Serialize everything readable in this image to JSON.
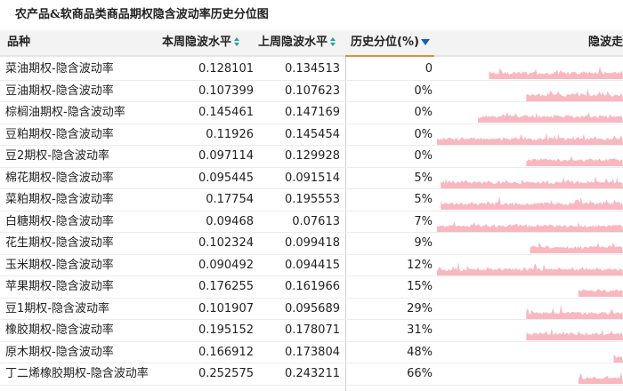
{
  "title": "农产品&软商品类商品期权隐含波动率历史分位图",
  "columns": {
    "name": "品种",
    "current": "本周隐波水平",
    "previous": "上周隐波水平",
    "percentile": "历史分位(%)",
    "trend": "隐波走"
  },
  "colors": {
    "spark_fill": "#f9b8c0",
    "sort_accent": "#2aa198",
    "active_sort_underline": "#e0923a"
  },
  "rows": [
    {
      "name": "菜油期权-隐含波动率",
      "current": "0.128101",
      "previous": "0.134513",
      "percentile": "0",
      "trend_start": 0.28
    },
    {
      "name": "豆油期权-隐含波动率",
      "current": "0.107399",
      "previous": "0.107623",
      "percentile": "0%",
      "trend_start": 0.48
    },
    {
      "name": "棕榈油期权-隐含波动率",
      "current": "0.145461",
      "previous": "0.147169",
      "percentile": "0%",
      "trend_start": 0.22
    },
    {
      "name": "豆粕期权-隐含波动率",
      "current": "0.11926",
      "previous": "0.145454",
      "percentile": "0%",
      "trend_start": 0.0
    },
    {
      "name": "豆2期权-隐含波动率",
      "current": "0.097114",
      "previous": "0.129928",
      "percentile": "0%",
      "trend_start": 0.48
    },
    {
      "name": "棉花期权-隐含波动率",
      "current": "0.095445",
      "previous": "0.091514",
      "percentile": "5%",
      "trend_start": 0.02
    },
    {
      "name": "菜粕期权-隐含波动率",
      "current": "0.17754",
      "previous": "0.195553",
      "percentile": "5%",
      "trend_start": 0.02
    },
    {
      "name": "白糖期权-隐含波动率",
      "current": "0.09468",
      "previous": "0.07613",
      "percentile": "7%",
      "trend_start": 0.0
    },
    {
      "name": "花生期权-隐含波动率",
      "current": "0.102324",
      "previous": "0.099418",
      "percentile": "9%",
      "trend_start": 0.5
    },
    {
      "name": "玉米期权-隐含波动率",
      "current": "0.090492",
      "previous": "0.094415",
      "percentile": "12%",
      "trend_start": 0.0
    },
    {
      "name": "苹果期权-隐含波动率",
      "current": "0.176255",
      "previous": "0.161966",
      "percentile": "15%",
      "trend_start": 0.76
    },
    {
      "name": "豆1期权-隐含波动率",
      "current": "0.101907",
      "previous": "0.095689",
      "percentile": "29%",
      "trend_start": 0.48
    },
    {
      "name": "橡胶期权-隐含波动率",
      "current": "0.195152",
      "previous": "0.178071",
      "percentile": "31%",
      "trend_start": 0.48
    },
    {
      "name": "原木期权-隐含波动率",
      "current": "0.166912",
      "previous": "0.173804",
      "percentile": "48%",
      "trend_start": 0.95
    },
    {
      "name": "丁二烯橡胶期权-隐含波动率",
      "current": "0.252575",
      "previous": "0.243211",
      "percentile": "66%",
      "trend_start": 0.76
    }
  ]
}
